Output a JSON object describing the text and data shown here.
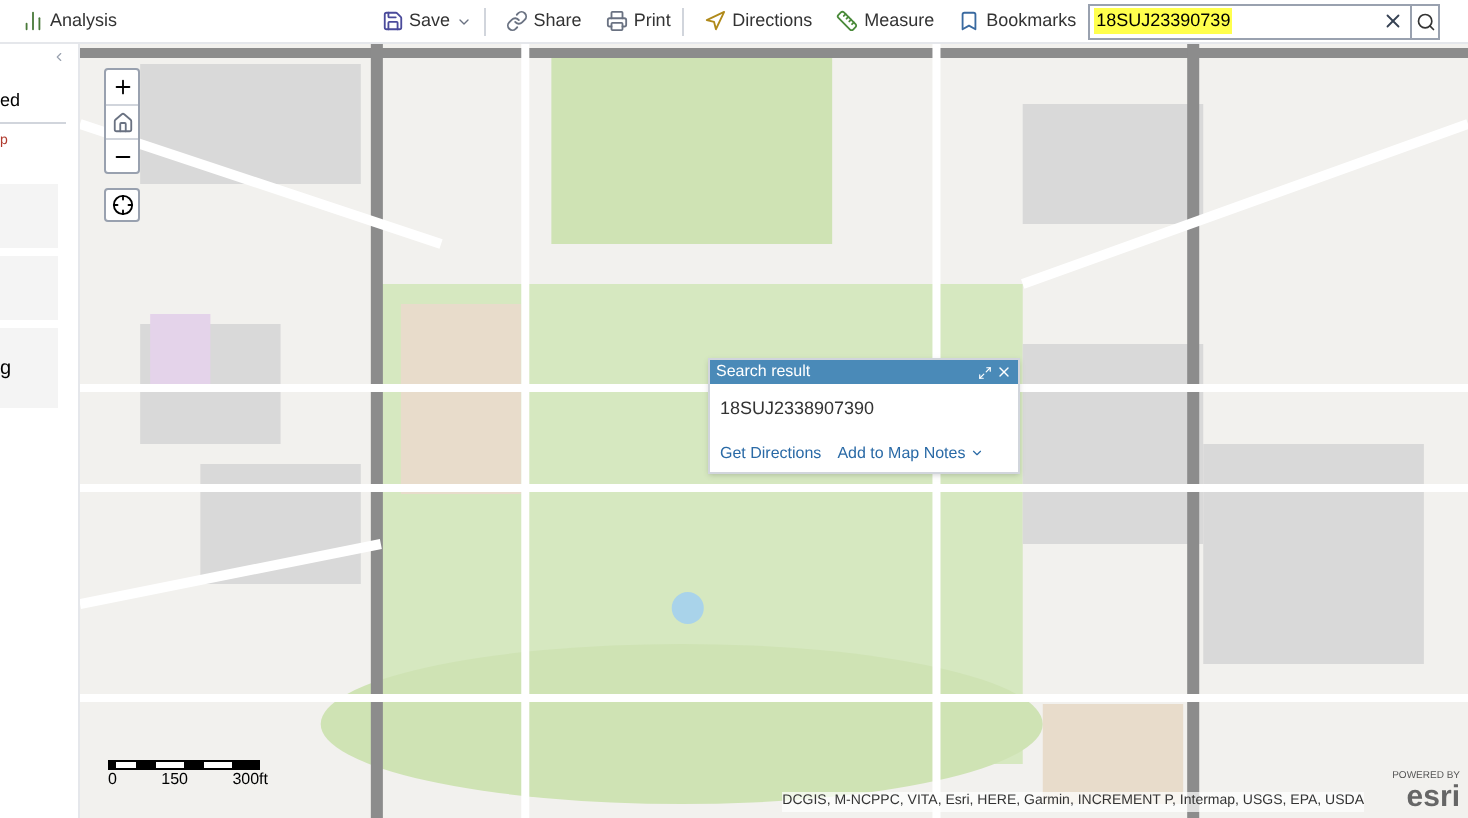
{
  "toolbar": {
    "items": [
      {
        "kind": "analysis",
        "label": "Analysis"
      },
      {
        "kind": "save",
        "label": "Save",
        "dropdown": true
      },
      {
        "kind": "share",
        "label": "Share"
      },
      {
        "kind": "print",
        "label": "Print"
      },
      {
        "kind": "directions",
        "label": "Directions"
      },
      {
        "kind": "measure",
        "label": "Measure"
      },
      {
        "kind": "bookmarks",
        "label": "Bookmarks"
      }
    ]
  },
  "search": {
    "value": "18SUJ23390739"
  },
  "side_panel": {
    "heading": "ed",
    "link": "p",
    "item": "g"
  },
  "popup": {
    "title": "Search result",
    "coordinate": "18SUJ2338907390",
    "actions": [
      {
        "label": "Get Directions",
        "dropdown": false
      },
      {
        "label": "Add to Map Notes",
        "dropdown": true
      }
    ]
  },
  "scale_bar": {
    "labels": [
      "0",
      "150",
      "300ft"
    ]
  },
  "attribution": "DCGIS, M-NCPPC, VITA, Esri, HERE, Garmin, INCREMENT P, Intermap, USGS, EPA, USDA",
  "logo": {
    "tagline": "POWERED BY",
    "name": "esri"
  }
}
